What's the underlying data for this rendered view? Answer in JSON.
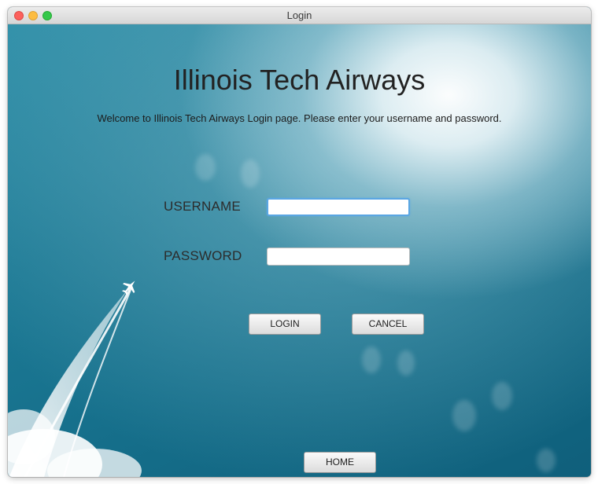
{
  "window": {
    "title": "Login"
  },
  "main": {
    "heading": "Illinois Tech Airways",
    "welcome": "Welcome to Illinois Tech Airways Login page. Please enter your username and password."
  },
  "form": {
    "username_label": "USERNAME",
    "username_value": "",
    "password_label": "PASSWORD",
    "password_value": "",
    "login_label": "LOGIN",
    "cancel_label": "CANCEL"
  },
  "footer": {
    "home_label": "HOME"
  },
  "colors": {
    "background_teal": "#1d7a95",
    "focus_ring": "#5aa6e3",
    "close": "#fc605c",
    "minimize": "#fdbc40",
    "maximize": "#34c84a"
  },
  "icons": [
    "airplane-icon"
  ]
}
